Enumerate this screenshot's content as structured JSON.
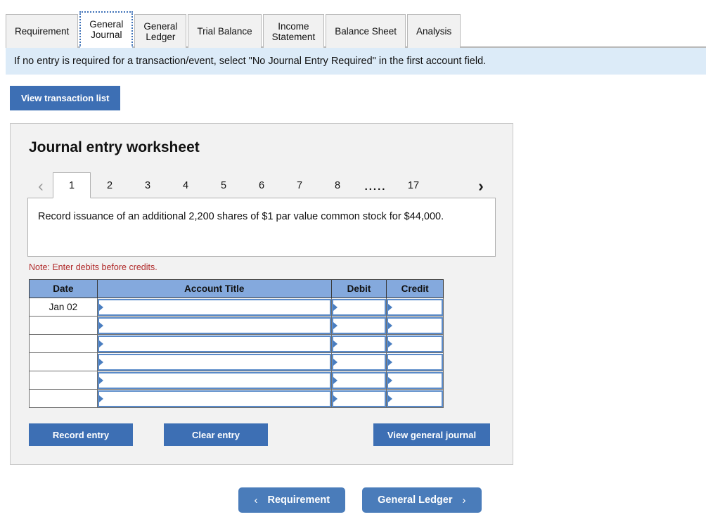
{
  "tabs": [
    {
      "label": "Requirement",
      "active": false
    },
    {
      "label": "General\nJournal",
      "active": true
    },
    {
      "label": "General\nLedger",
      "active": false
    },
    {
      "label": "Trial Balance",
      "active": false
    },
    {
      "label": "Income\nStatement",
      "active": false
    },
    {
      "label": "Balance Sheet",
      "active": false
    },
    {
      "label": "Analysis",
      "active": false
    }
  ],
  "banner": {
    "text": "If no entry is required for a transaction/event, select \"No Journal Entry Required\" in the first account field."
  },
  "toolbar": {
    "view_transaction_list_label": "View transaction list"
  },
  "worksheet": {
    "title": "Journal entry worksheet",
    "pager": {
      "prev_icon": "‹",
      "next_icon": "›",
      "pages": [
        "1",
        "2",
        "3",
        "4",
        "5",
        "6",
        "7",
        "8"
      ],
      "ellipsis": ".....",
      "last_page": "17",
      "active_page": "1"
    },
    "description": "Record issuance of an additional 2,200 shares of $1 par value common stock for $44,000.",
    "note": "Note: Enter debits before credits.",
    "table": {
      "headers": [
        "Date",
        "Account Title",
        "Debit",
        "Credit"
      ],
      "rows": [
        {
          "date": "Jan 02",
          "account": "",
          "debit": "",
          "credit": ""
        },
        {
          "date": "",
          "account": "",
          "debit": "",
          "credit": ""
        },
        {
          "date": "",
          "account": "",
          "debit": "",
          "credit": ""
        },
        {
          "date": "",
          "account": "",
          "debit": "",
          "credit": ""
        },
        {
          "date": "",
          "account": "",
          "debit": "",
          "credit": ""
        },
        {
          "date": "",
          "account": "",
          "debit": "",
          "credit": ""
        }
      ]
    },
    "actions": {
      "record_entry_label": "Record entry",
      "clear_entry_label": "Clear entry",
      "view_general_journal_label": "View general journal"
    }
  },
  "bottom_nav": {
    "prev_chevron": "‹",
    "prev_label": "Requirement",
    "next_label": "General Ledger",
    "next_chevron": "›"
  },
  "colors": {
    "accent_blue": "#3d6fb4",
    "nav_blue": "#4a7cba",
    "table_header_blue": "#84a9dd",
    "banner_blue": "#dcebf8",
    "input_border_blue": "#5b8bc9",
    "note_red": "#b02a2a",
    "card_gray": "#f2f2f2"
  }
}
